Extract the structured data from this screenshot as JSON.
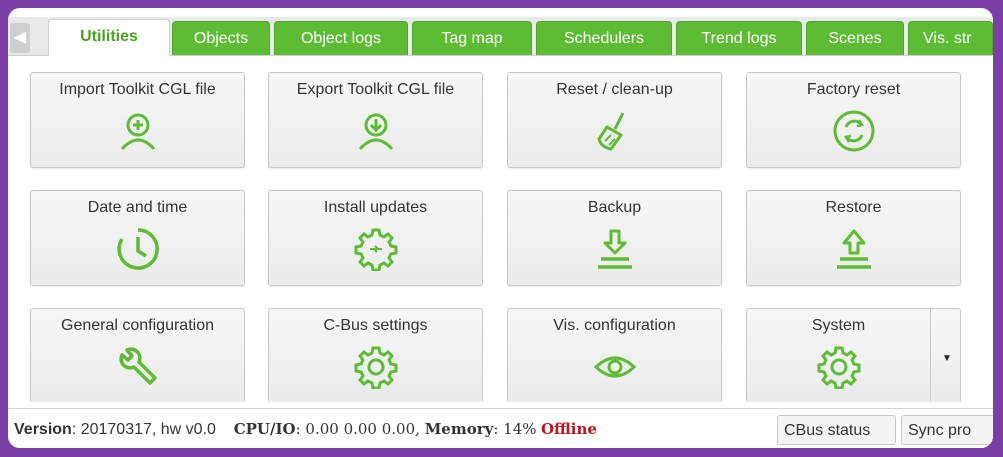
{
  "tabs": [
    {
      "label": "Utilities",
      "active": true
    },
    {
      "label": "Objects",
      "active": false
    },
    {
      "label": "Object logs",
      "active": false
    },
    {
      "label": "Tag map",
      "active": false
    },
    {
      "label": "Schedulers",
      "active": false
    },
    {
      "label": "Trend logs",
      "active": false
    },
    {
      "label": "Scenes",
      "active": false
    },
    {
      "label": "Vis. str",
      "active": false
    }
  ],
  "scroll_left_icon": "arrow-left-icon",
  "tiles": [
    {
      "label": "Import Toolkit CGL file",
      "icon": "import-user-icon"
    },
    {
      "label": "Export Toolkit CGL file",
      "icon": "export-user-icon"
    },
    {
      "label": "Reset / clean-up",
      "icon": "broom-icon"
    },
    {
      "label": "Factory reset",
      "icon": "refresh-circle-icon"
    },
    {
      "label": "Date and time",
      "icon": "clock-icon"
    },
    {
      "label": "Install updates",
      "icon": "gear-update-icon"
    },
    {
      "label": "Backup",
      "icon": "backup-icon"
    },
    {
      "label": "Restore",
      "icon": "restore-icon"
    },
    {
      "label": "General configuration",
      "icon": "wrench-icon"
    },
    {
      "label": "C-Bus settings",
      "icon": "gear-icon"
    },
    {
      "label": "Vis. configuration",
      "icon": "eye-icon"
    },
    {
      "label": "System",
      "icon": "gear-icon"
    }
  ],
  "status": {
    "version_label": "Version",
    "version_value": ": 20170317, hw v0.0",
    "cpu_label": "CPU/IO",
    "cpu_value": ": 0.00 0.00 0.00",
    "memory_label": "Memory",
    "memory_value": ": 14%",
    "offline": "Offline",
    "cbus_button": "CBus status",
    "sync_button": "Sync pro"
  },
  "colors": {
    "accent": "#5dbb34",
    "offline": "#c0141c",
    "frame": "#7b3fa6"
  }
}
